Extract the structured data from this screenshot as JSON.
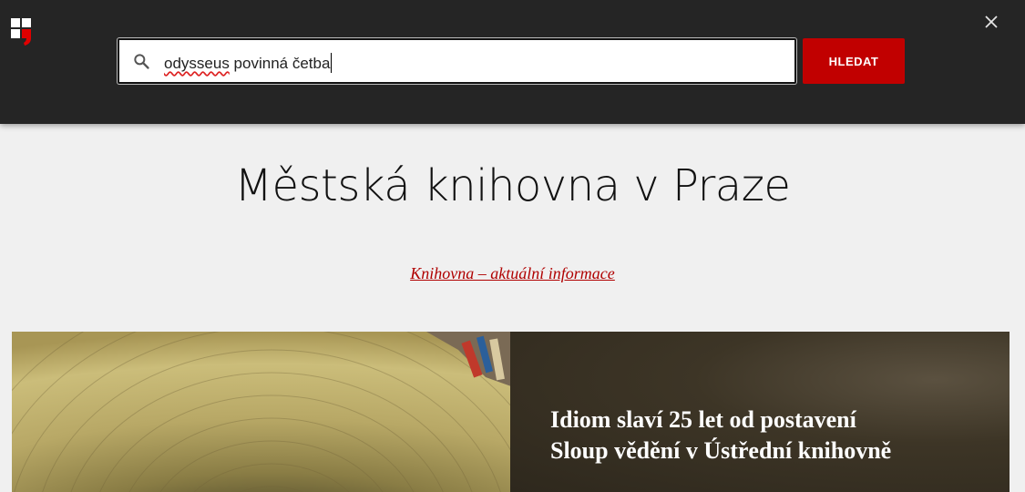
{
  "search": {
    "value_misspelled": "odysseus",
    "value_rest": " povinná četba",
    "button_label": "HLEDAT"
  },
  "icons": {
    "logo": "library-logo-icon",
    "close": "close-icon",
    "search": "search-icon"
  },
  "colors": {
    "topbar": "#252525",
    "accent": "#c10000",
    "link": "#b00000",
    "page_bg": "#f0f0f0"
  },
  "main": {
    "title": "Městská knihovna v Praze",
    "info_link": "Knihovna – aktuální informace"
  },
  "hero": {
    "headline_line1": "Idiom slaví 25 let od postavení",
    "headline_line2": "Sloup vědění v Ústřední knihovně"
  }
}
